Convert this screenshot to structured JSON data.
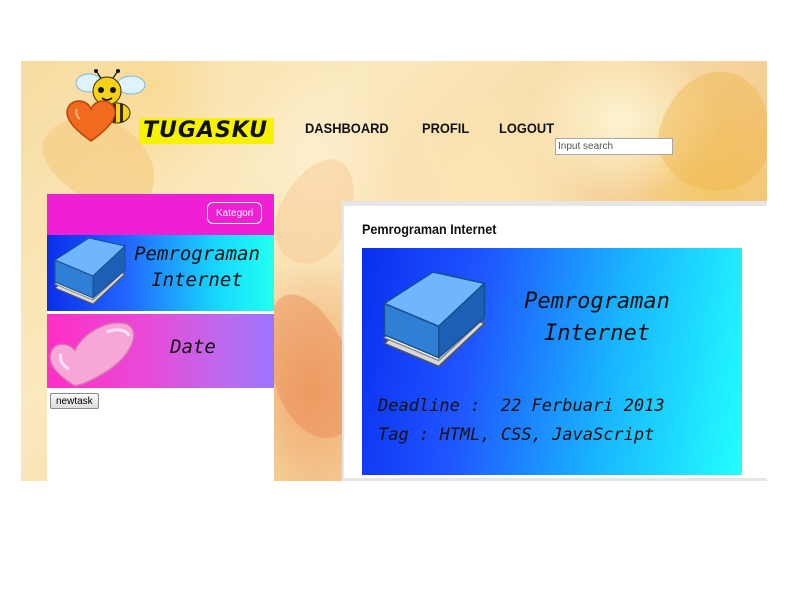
{
  "header": {
    "logo_text": "TUGASKU",
    "nav": [
      "DASHBOARD",
      "PROFIL",
      "LOGOUT"
    ],
    "search_placeholder": "Input search"
  },
  "sidebar": {
    "kategori_label": "Kategori",
    "categories": [
      {
        "label": "Pemrograman Internet",
        "icon": "book-icon"
      },
      {
        "label": "Date",
        "icon": "heart-icon"
      }
    ],
    "newtask_label": "newtask"
  },
  "main": {
    "title": "Pemrograman Internet",
    "card": {
      "title": "Pemrograman Internet",
      "deadline_label": "Deadline",
      "deadline_value": "22 Ferbuari 2013",
      "tag_label": "Tag",
      "tag_value": "HTML, CSS, JavaScript"
    }
  },
  "colors": {
    "magenta": "#ee1fd4",
    "blue": "#0a2ef0",
    "cyan": "#22ffff"
  }
}
